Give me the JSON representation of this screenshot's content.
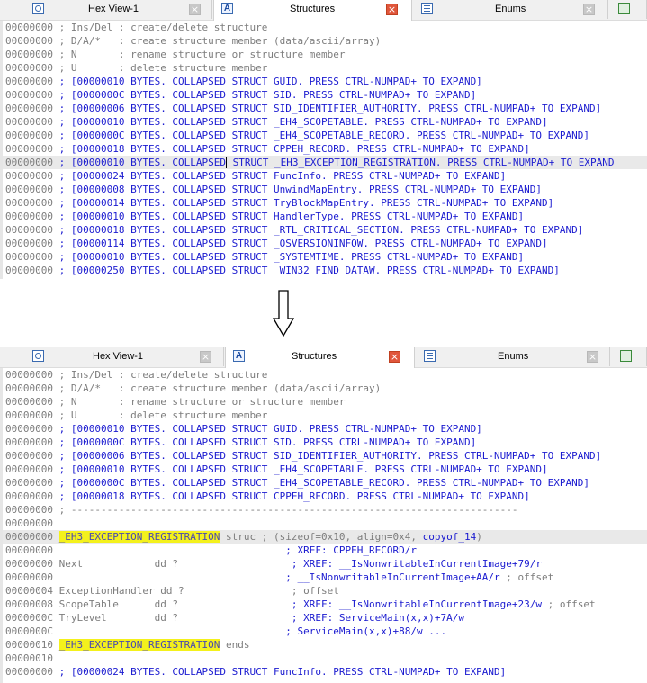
{
  "tabs": [
    {
      "label": "Hex View-1",
      "icon": "hex-view-icon"
    },
    {
      "label": "Structures",
      "icon": "structures-icon"
    },
    {
      "label": "Enums",
      "icon": "enums-icon"
    },
    {
      "label": "",
      "icon": "imports-icon"
    }
  ],
  "top_listing": {
    "header": [
      {
        "addr": "00000000",
        "text": " ; Ins/Del : create/delete structure"
      },
      {
        "addr": "00000000",
        "text": " ; D/A/*   : create structure member (data/ascii/array)"
      },
      {
        "addr": "00000000",
        "text": " ; N       : rename structure or structure member"
      },
      {
        "addr": "00000000",
        "text": " ; U       : delete structure member"
      }
    ],
    "structs": [
      {
        "addr": "00000000",
        "text": " ; [00000010 BYTES. COLLAPSED STRUCT GUID. PRESS CTRL-NUMPAD+ TO EXPAND]"
      },
      {
        "addr": "00000000",
        "text": " ; [0000000C BYTES. COLLAPSED STRUCT SID. PRESS CTRL-NUMPAD+ TO EXPAND]"
      },
      {
        "addr": "00000000",
        "text": " ; [00000006 BYTES. COLLAPSED STRUCT SID_IDENTIFIER_AUTHORITY. PRESS CTRL-NUMPAD+ TO EXPAND]"
      },
      {
        "addr": "00000000",
        "text": " ; [00000010 BYTES. COLLAPSED STRUCT _EH4_SCOPETABLE. PRESS CTRL-NUMPAD+ TO EXPAND]"
      },
      {
        "addr": "00000000",
        "text": " ; [0000000C BYTES. COLLAPSED STRUCT _EH4_SCOPETABLE_RECORD. PRESS CTRL-NUMPAD+ TO EXPAND]"
      },
      {
        "addr": "00000000",
        "text": " ; [00000018 BYTES. COLLAPSED STRUCT CPPEH_RECORD. PRESS CTRL-NUMPAD+ TO EXPAND]"
      },
      {
        "addr": "00000000",
        "text_before_cursor": " ; [00000010 BYTES. COLLAPSED",
        "text_after_cursor": " STRUCT _EH3_EXCEPTION_REGISTRATION. PRESS CTRL-NUMPAD+ TO EXPAND",
        "highlight": true
      },
      {
        "addr": "00000000",
        "text": " ; [00000024 BYTES. COLLAPSED STRUCT FuncInfo. PRESS CTRL-NUMPAD+ TO EXPAND]"
      },
      {
        "addr": "00000000",
        "text": " ; [00000008 BYTES. COLLAPSED STRUCT UnwindMapEntry. PRESS CTRL-NUMPAD+ TO EXPAND]"
      },
      {
        "addr": "00000000",
        "text": " ; [00000014 BYTES. COLLAPSED STRUCT TryBlockMapEntry. PRESS CTRL-NUMPAD+ TO EXPAND]"
      },
      {
        "addr": "00000000",
        "text": " ; [00000010 BYTES. COLLAPSED STRUCT HandlerType. PRESS CTRL-NUMPAD+ TO EXPAND]"
      },
      {
        "addr": "00000000",
        "text": " ; [00000018 BYTES. COLLAPSED STRUCT _RTL_CRITICAL_SECTION. PRESS CTRL-NUMPAD+ TO EXPAND]"
      },
      {
        "addr": "00000000",
        "text": " ; [00000114 BYTES. COLLAPSED STRUCT _OSVERSIONINFOW. PRESS CTRL-NUMPAD+ TO EXPAND]"
      },
      {
        "addr": "00000000",
        "text": " ; [00000010 BYTES. COLLAPSED STRUCT _SYSTEMTIME. PRESS CTRL-NUMPAD+ TO EXPAND]"
      },
      {
        "addr": "00000000",
        "text": " ; [00000250 BYTES. COLLAPSED STRUCT  WIN32 FIND DATAW. PRESS CTRL-NUMPAD+ TO EXPAND]"
      }
    ]
  },
  "bottom_listing": {
    "header": [
      {
        "addr": "00000000",
        "text": " ; Ins/Del : create/delete structure"
      },
      {
        "addr": "00000000",
        "text": " ; D/A/*   : create structure member (data/ascii/array)"
      },
      {
        "addr": "00000000",
        "text": " ; N       : rename structure or structure member"
      },
      {
        "addr": "00000000",
        "text": " ; U       : delete structure member"
      }
    ],
    "structs": [
      {
        "addr": "00000000",
        "text": " ; [00000010 BYTES. COLLAPSED STRUCT GUID. PRESS CTRL-NUMPAD+ TO EXPAND]"
      },
      {
        "addr": "00000000",
        "text": " ; [0000000C BYTES. COLLAPSED STRUCT SID. PRESS CTRL-NUMPAD+ TO EXPAND]"
      },
      {
        "addr": "00000000",
        "text": " ; [00000006 BYTES. COLLAPSED STRUCT SID_IDENTIFIER_AUTHORITY. PRESS CTRL-NUMPAD+ TO EXPAND]"
      },
      {
        "addr": "00000000",
        "text": " ; [00000010 BYTES. COLLAPSED STRUCT _EH4_SCOPETABLE. PRESS CTRL-NUMPAD+ TO EXPAND]"
      },
      {
        "addr": "00000000",
        "text": " ; [0000000C BYTES. COLLAPSED STRUCT _EH4_SCOPETABLE_RECORD. PRESS CTRL-NUMPAD+ TO EXPAND]"
      },
      {
        "addr": "00000000",
        "text": " ; [00000018 BYTES. COLLAPSED STRUCT CPPEH_RECORD. PRESS CTRL-NUMPAD+ TO EXPAND]"
      }
    ],
    "separator": {
      "addr": "00000000",
      "text": " ; ---------------------------------------------------------------------------"
    },
    "blank1": {
      "addr": "00000000"
    },
    "struct_head": {
      "addr": "00000000",
      "name": "_EH3_EXCEPTION_REGISTRATION",
      "rest": " struc ; (sizeof=0x10, align=0x4, ",
      "copyof": "copyof_14",
      "close": ")"
    },
    "xref1": {
      "addr": "00000000",
      "text": "                                       ; XREF: CPPEH_RECORD/r"
    },
    "member_next": {
      "addr": "00000000",
      "text": " Next            dd ?",
      "comment": "                   ; XREF: __IsNonwritableInCurrentImage+79/r"
    },
    "xref2": {
      "addr": "00000000",
      "text": "                                       ; __IsNonwritableInCurrentImage+AA/r",
      "tail": " ; offset"
    },
    "member_handler": {
      "addr": "00000004",
      "text": " ExceptionHandler dd ?",
      "comment": "                  ; offset"
    },
    "member_scope": {
      "addr": "00000008",
      "text": " ScopeTable      dd ?",
      "comment": "                   ; XREF: __IsNonwritableInCurrentImage+23/w",
      "tail": " ; offset"
    },
    "member_try": {
      "addr": "0000000C",
      "text": " TryLevel        dd ?",
      "comment": "                   ; XREF: ServiceMain(x,x)+7A/w"
    },
    "xref3": {
      "addr": "0000000C",
      "text": "                                       ; ServiceMain(x,x)+88/w ..."
    },
    "struct_end": {
      "addr": "00000010",
      "name": "_EH3_EXCEPTION_REGISTRATION",
      "rest": " ends"
    },
    "blank2": {
      "addr": "00000010"
    },
    "last": {
      "addr": "00000000",
      "text": " ; [00000024 BYTES. COLLAPSED STRUCT FuncInfo. PRESS CTRL-NUMPAD+ TO EXPAND]"
    }
  },
  "colors": {
    "comment_gray": "#7d7d7d",
    "collapsed_blue": "#1b1bd0",
    "name_highlight": "#f4f11c",
    "line_highlight": "#e9e9e9"
  }
}
